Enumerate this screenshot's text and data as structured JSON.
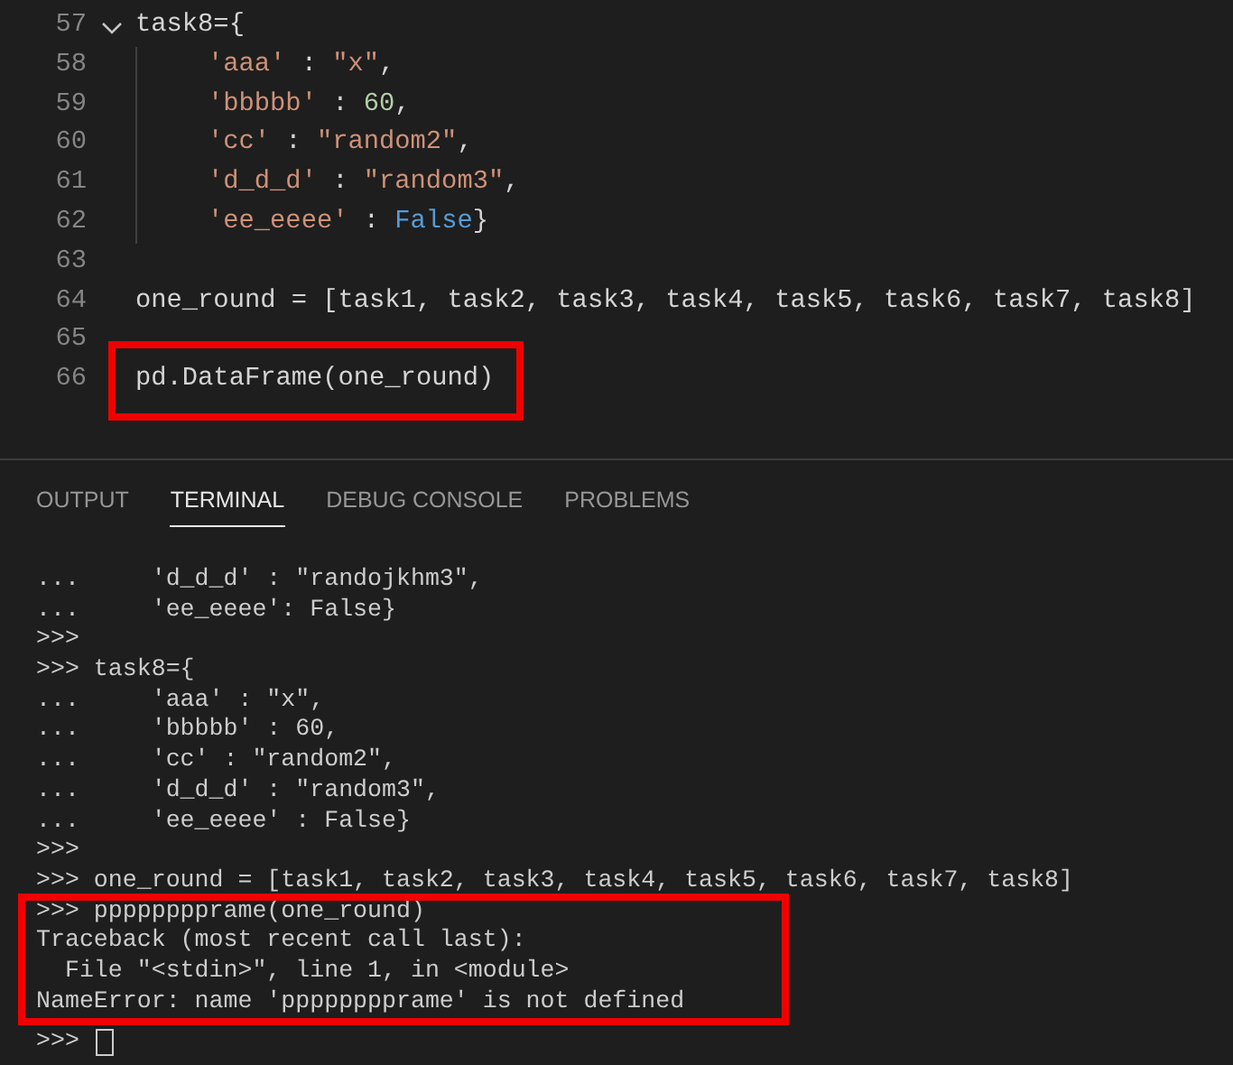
{
  "editor": {
    "lines": [
      {
        "number": "57",
        "kind": "fold-start",
        "expanded": true,
        "boxed": false,
        "tokens": [
          {
            "t": "task8={",
            "kind": "plain"
          }
        ]
      },
      {
        "number": "58",
        "kind": "indented",
        "boxed": false,
        "tokens": [
          {
            "t": "'aaa'",
            "kind": "string"
          },
          {
            "t": " : ",
            "kind": "plain"
          },
          {
            "t": "\"x\"",
            "kind": "string"
          },
          {
            "t": ",",
            "kind": "plain"
          }
        ]
      },
      {
        "number": "59",
        "kind": "indented",
        "boxed": false,
        "tokens": [
          {
            "t": "'bbbbb'",
            "kind": "string"
          },
          {
            "t": " : ",
            "kind": "plain"
          },
          {
            "t": "60",
            "kind": "number"
          },
          {
            "t": ",",
            "kind": "plain"
          }
        ]
      },
      {
        "number": "60",
        "kind": "indented",
        "boxed": false,
        "tokens": [
          {
            "t": "'cc'",
            "kind": "string"
          },
          {
            "t": " : ",
            "kind": "plain"
          },
          {
            "t": "\"random2\"",
            "kind": "string"
          },
          {
            "t": ",",
            "kind": "plain"
          }
        ]
      },
      {
        "number": "61",
        "kind": "indented",
        "boxed": false,
        "tokens": [
          {
            "t": "'d_d_d'",
            "kind": "string"
          },
          {
            "t": " : ",
            "kind": "plain"
          },
          {
            "t": "\"random3\"",
            "kind": "string"
          },
          {
            "t": ",",
            "kind": "plain"
          }
        ]
      },
      {
        "number": "62",
        "kind": "indented",
        "boxed": false,
        "tokens": [
          {
            "t": "'ee_eeee'",
            "kind": "string"
          },
          {
            "t": " : ",
            "kind": "plain"
          },
          {
            "t": "False",
            "kind": "keyword"
          },
          {
            "t": "}",
            "kind": "plain"
          }
        ]
      },
      {
        "number": "63",
        "kind": "code",
        "boxed": false
      },
      {
        "number": "64",
        "kind": "code",
        "boxed": false,
        "tokens": [
          {
            "t": "one_round = [task1, task2, task3, task4, task5, task6, task7, task8]",
            "kind": "plain"
          }
        ]
      },
      {
        "number": "65",
        "kind": "code",
        "boxed": false
      },
      {
        "number": "66",
        "kind": "code",
        "boxed": true,
        "tokens": [
          {
            "t": "pd.DataFrame(one_round)",
            "kind": "plain"
          }
        ]
      }
    ]
  },
  "panel": {
    "tabs": [
      {
        "label": "OUTPUT",
        "selected": false
      },
      {
        "label": "TERMINAL",
        "selected": true
      },
      {
        "label": "DEBUG CONSOLE",
        "selected": false
      },
      {
        "label": "PROBLEMS",
        "selected": false
      }
    ],
    "terminal": {
      "lines": [
        {
          "text": "...     'd_d_d' : \"randojkhm3\",",
          "boxed": false
        },
        {
          "text": "...     'ee_eeee': False}",
          "boxed": false
        },
        {
          "text": ">>>",
          "boxed": false
        },
        {
          "text": ">>> task8={",
          "boxed": false
        },
        {
          "text": "...     'aaa' : \"x\",",
          "boxed": false
        },
        {
          "text": "...     'bbbbb' : 60,",
          "boxed": false
        },
        {
          "text": "...     'cc' : \"random2\",",
          "boxed": false
        },
        {
          "text": "...     'd_d_d' : \"random3\",",
          "boxed": false
        },
        {
          "text": "...     'ee_eeee' : False}",
          "boxed": false
        },
        {
          "text": ">>>",
          "boxed": false
        },
        {
          "text": ">>> one_round = [task1, task2, task3, task4, task5, task6, task7, task8]",
          "boxed": false
        },
        {
          "text": ">>> pppppppprame(one_round)",
          "boxed": true
        },
        {
          "text": "Traceback (most recent call last):",
          "boxed": true
        },
        {
          "text": "  File \"<stdin>\", line 1, in <module>",
          "boxed": true
        },
        {
          "text": "NameError: name 'pppppppprame' is not defined",
          "boxed": true
        },
        {
          "text": ">>>",
          "boxed": false,
          "cursor": true
        }
      ]
    }
  }
}
